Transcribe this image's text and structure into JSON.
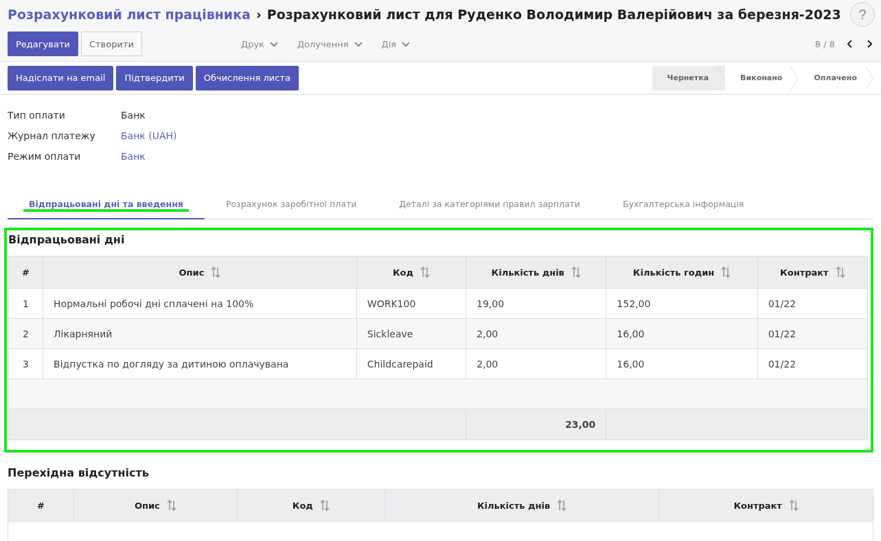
{
  "breadcrumb": {
    "parent": "Розрахунковий лист працівника",
    "separator": "›",
    "current": "Розрахунковий лист для Руденко Володимир Валерійович за березня-2023"
  },
  "help": "?",
  "buttons": [
    {
      "label": "Редагувати",
      "kind": "primary"
    },
    {
      "label": "Створити",
      "kind": "secondary"
    }
  ],
  "dropdowns": [
    "Друк",
    "Долучення",
    "Дія"
  ],
  "pager": "8 / 8",
  "actions": [
    "Надіслати на email",
    "Підтвердити",
    "Обчислення листа"
  ],
  "stages": [
    {
      "label": "Чернетка",
      "selected": true
    },
    {
      "label": "Виконано",
      "selected": false
    },
    {
      "label": "Оплачено",
      "selected": false
    }
  ],
  "fields": [
    {
      "label": "Тип оплати",
      "value": "Банк",
      "kind": "text"
    },
    {
      "label": "Журнал платежу",
      "value": "Банк (UAH)",
      "kind": "link"
    },
    {
      "label": "Режим оплати",
      "value": "Банк",
      "kind": "link"
    }
  ],
  "tabs": [
    {
      "label": "Відпрацьовані дні та введення",
      "selected": true
    },
    {
      "label": "Розрахунок заробітної плати",
      "selected": false
    },
    {
      "label": "Деталі за категоріями правил зарплати",
      "selected": false
    },
    {
      "label": "Бухгалтерська інформація",
      "selected": false
    }
  ],
  "worked_days": {
    "title": "Відпрацьовані дні",
    "columns": [
      "#",
      "Опис",
      "Код",
      "Кількість днів",
      "Кількість годин",
      "Контракт"
    ],
    "rows": [
      [
        "1",
        "Нормальні робочі дні сплачені на 100%",
        "WORK100",
        "19,00",
        "152,00",
        "01/22"
      ],
      [
        "2",
        "Лікарняний",
        "Sickleave",
        "2,00",
        "16,00",
        "01/22"
      ],
      [
        "3",
        "Відпустка по догляду за дитиною оплачувана",
        "Childcarepaid",
        "2,00",
        "16,00",
        "01/22"
      ]
    ],
    "total": "23,00"
  },
  "absence": {
    "title": "Перехідна відсутність",
    "columns": [
      "#",
      "Опис",
      "Код",
      "Кількість днів",
      "Контракт"
    ]
  }
}
